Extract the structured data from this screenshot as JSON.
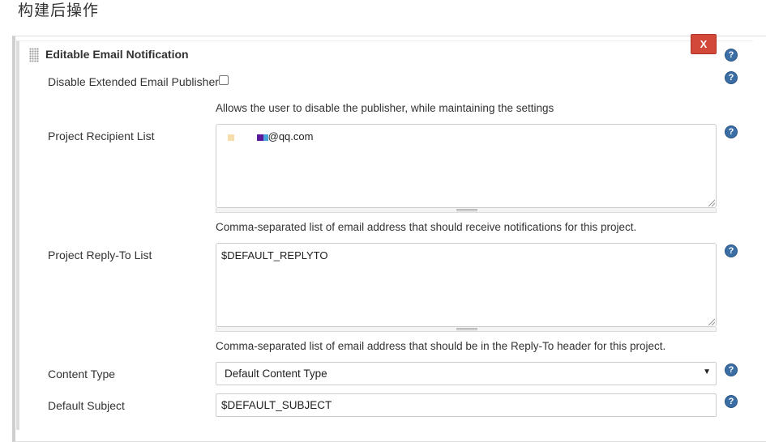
{
  "section": {
    "heading": "构建后操作"
  },
  "block": {
    "title": "Editable Email Notification",
    "delete_label": "X"
  },
  "help": {
    "glyph": "?"
  },
  "disable_publisher": {
    "label": "Disable Extended Email Publisher",
    "checked": false,
    "description": "Allows the user to disable the publisher, while maintaining the settings"
  },
  "recipient_list": {
    "label": "Project Recipient List",
    "value": "@qq.com",
    "description": "Comma-separated list of email address that should receive notifications for this project."
  },
  "reply_to_list": {
    "label": "Project Reply-To List",
    "value": "$DEFAULT_REPLYTO",
    "description": "Comma-separated list of email address that should be in the Reply-To header for this project."
  },
  "content_type": {
    "label": "Content Type",
    "selected": "Default Content Type",
    "caret": "▼"
  },
  "default_subject": {
    "label": "Default Subject",
    "value": "$DEFAULT_SUBJECT"
  },
  "colors": {
    "delete_button": "#d24939",
    "help_icon": "#3a6ea5",
    "swatch_1": "#f5deaa",
    "swatch_2": "#5b1a9a",
    "swatch_3": "#4aa3d8"
  }
}
